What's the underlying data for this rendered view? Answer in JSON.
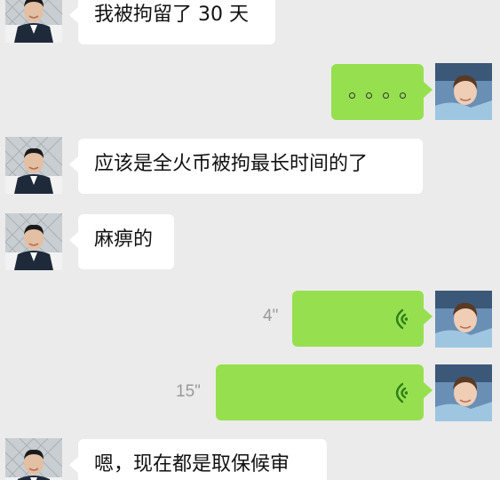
{
  "messages": [
    {
      "sender": "friend",
      "type": "text",
      "text": "我被拘留了 30 天"
    },
    {
      "sender": "me",
      "type": "typing",
      "text": ""
    },
    {
      "sender": "friend",
      "type": "text",
      "text": "应该是全火币被拘最长时间的了"
    },
    {
      "sender": "friend",
      "type": "text",
      "text": "麻痹的"
    },
    {
      "sender": "me",
      "type": "voice",
      "duration": "4\""
    },
    {
      "sender": "me",
      "type": "voice",
      "duration": "15\""
    },
    {
      "sender": "friend",
      "type": "text",
      "text": "嗯，现在都是取保候审"
    }
  ],
  "colors": {
    "background": "#ebebeb",
    "incoming_bubble": "#ffffff",
    "outgoing_bubble": "#96e04f",
    "voice_icon": "#2e7d18",
    "duration_text": "#9a9a9a"
  },
  "icons": {
    "friend_avatar": "friend-avatar-photo",
    "my_avatar": "my-avatar-photo",
    "voice": "voice-wave-icon"
  }
}
